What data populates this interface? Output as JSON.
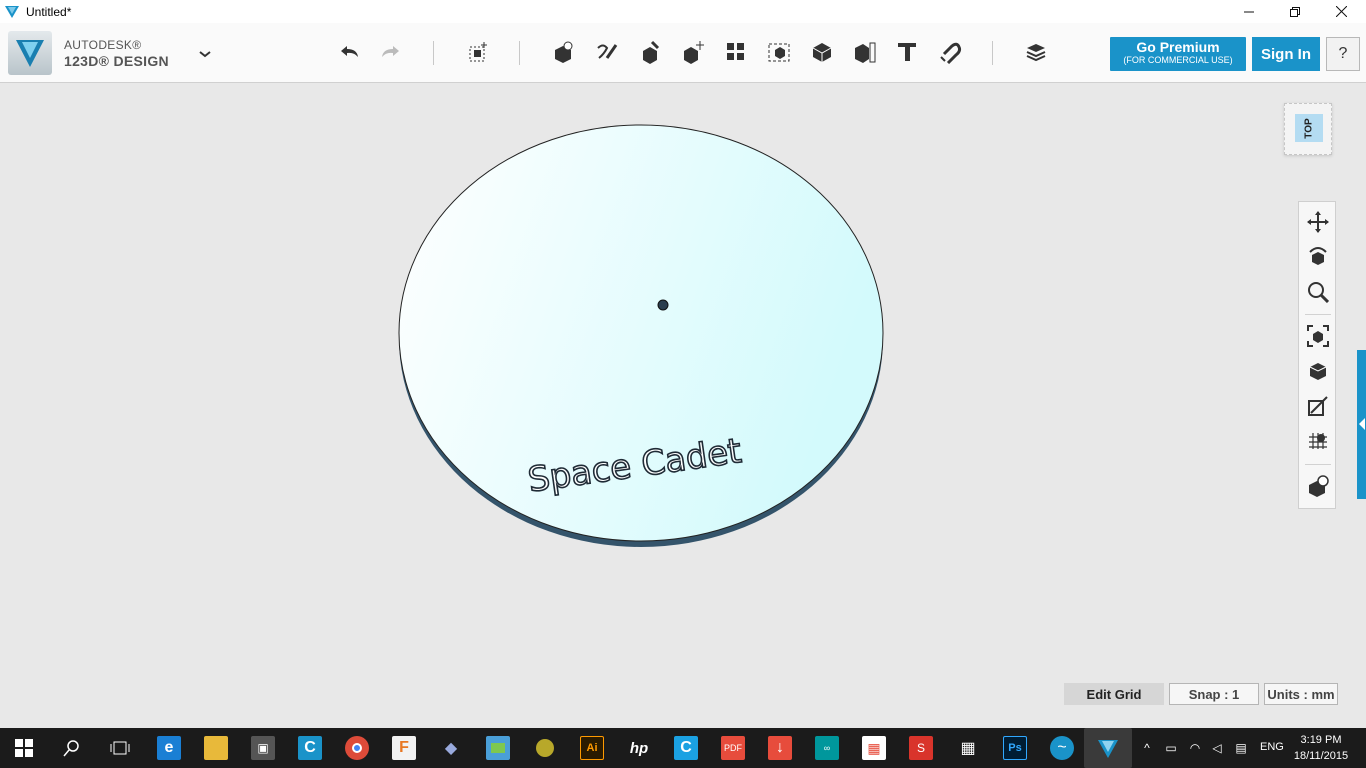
{
  "window": {
    "title": "Untitled*",
    "minimize_icon": "minimize-icon",
    "maximize_icon": "restore-icon",
    "close_icon": "close-icon"
  },
  "brand": {
    "line1": "AUTODESK®",
    "line2": "123D® DESIGN",
    "logo_icon": "123d-logo-icon"
  },
  "toolbar": {
    "undo_icon": "undo-icon",
    "redo_icon": "redo-icon",
    "tools": [
      "transform-icon",
      "primitives-icon",
      "sketch-icon",
      "construct-icon",
      "modify-icon",
      "pattern-icon",
      "grouping-icon",
      "combine-icon",
      "measure-icon",
      "text-icon",
      "snap-icon",
      "material-icon"
    ],
    "premium_label": "Go Premium",
    "premium_sub": "(FOR COMMERCIAL USE)",
    "signin_label": "Sign In",
    "help_label": "?"
  },
  "scene": {
    "engraved_text": "Space Cadet",
    "disc_color": "#dff8fb",
    "edge_color": "#2f4f66"
  },
  "viewcube": {
    "face_label": "TOP"
  },
  "navbar": {
    "items": [
      "pan-icon",
      "orbit-icon",
      "zoom-icon",
      "fit-icon",
      "view-solid-icon",
      "materials-outline-icon",
      "grid-icon",
      "physical-material-icon"
    ]
  },
  "status": {
    "edit_grid_label": "Edit Grid",
    "snap_label": "Snap  :  1",
    "units_label": "Units : mm"
  },
  "taskbar": {
    "language": "ENG",
    "time": "3:19 PM",
    "date": "18/11/2015",
    "accent": "#1a93c9"
  }
}
